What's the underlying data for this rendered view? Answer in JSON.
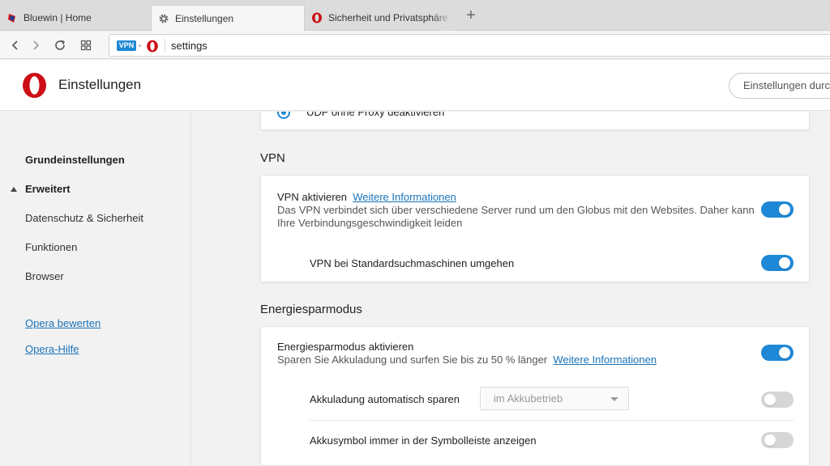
{
  "tabs": [
    {
      "label": "Bluewin | Home",
      "icon": "bluewin-icon"
    },
    {
      "label": "Einstellungen",
      "icon": "gear-icon"
    },
    {
      "label": "Sicherheit und Privatsphäre -",
      "icon": "opera-icon"
    }
  ],
  "address_bar": {
    "vpn_badge": "VPN",
    "url": "settings"
  },
  "header": {
    "title": "Einstellungen",
    "search_placeholder": "Einstellungen durchsuchen"
  },
  "sidebar": {
    "items": [
      {
        "label": "Grundeinstellungen"
      },
      {
        "label": "Erweitert"
      },
      {
        "label": "Datenschutz & Sicherheit"
      },
      {
        "label": "Funktionen"
      },
      {
        "label": "Browser"
      }
    ],
    "links": [
      {
        "label": "Opera bewerten"
      },
      {
        "label": "Opera-Hilfe"
      }
    ]
  },
  "top_card": {
    "radio_label": "UDP ohne Proxy deaktivieren"
  },
  "vpn": {
    "section_title": "VPN",
    "enable_label": "VPN aktivieren",
    "enable_link": "Weitere Informationen",
    "enable_description": "Das VPN verbindet sich über verschiedene Server rund um den Globus mit den Websites. Daher kann Ihre Verbindungsgeschwindigkeit leiden",
    "enable_on": true,
    "bypass_label": "VPN bei Standardsuchmaschinen umgehen",
    "bypass_on": true
  },
  "battery": {
    "section_title": "Energiesparmodus",
    "enable_label": "Energiesparmodus aktivieren",
    "enable_description": "Sparen Sie Akkuladung und surfen Sie bis zu 50 % länger",
    "enable_link": "Weitere Informationen",
    "enable_on": true,
    "auto_label": "Akkuladung automatisch sparen",
    "auto_select": "im Akkubetrieb",
    "auto_on": false,
    "icon_label": "Akkusymbol immer in der Symbolleiste anzeigen",
    "icon_on": false
  },
  "colors": {
    "accent": "#1e88d6",
    "opera_red": "#cc0f16",
    "link": "#1a73b8"
  }
}
